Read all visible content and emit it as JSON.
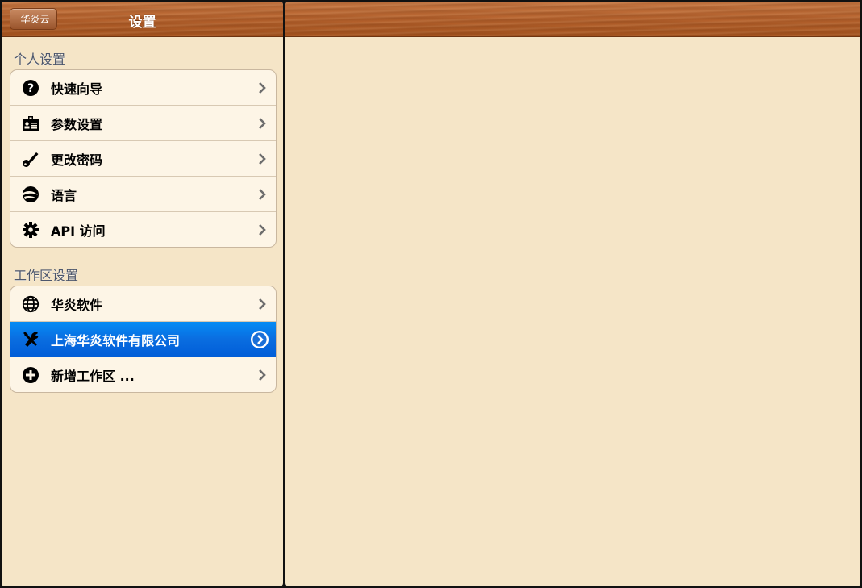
{
  "nav": {
    "back_label": "华炎云",
    "title": "设置"
  },
  "personal": {
    "header": "个人设置",
    "items": [
      {
        "label": "快速向导",
        "icon": "question-icon"
      },
      {
        "label": "参数设置",
        "icon": "id-card-icon"
      },
      {
        "label": "更改密码",
        "icon": "key-icon"
      },
      {
        "label": "语言",
        "icon": "globe-swoosh-icon"
      },
      {
        "label": "API 访问",
        "icon": "gear-icon"
      }
    ]
  },
  "workspace": {
    "header": "工作区设置",
    "items": [
      {
        "label": "华炎软件",
        "icon": "globe-icon",
        "selected": false
      },
      {
        "label": "上海华炎软件有限公司",
        "icon": "tools-icon",
        "selected": true
      },
      {
        "label": "新增工作区 ...",
        "icon": "plus-circle-icon",
        "selected": false
      }
    ]
  },
  "colors": {
    "background": "#f5e5c7",
    "cell": "#fdf5e6",
    "selected": "#0a6de0",
    "header_text": "#4c566c"
  }
}
